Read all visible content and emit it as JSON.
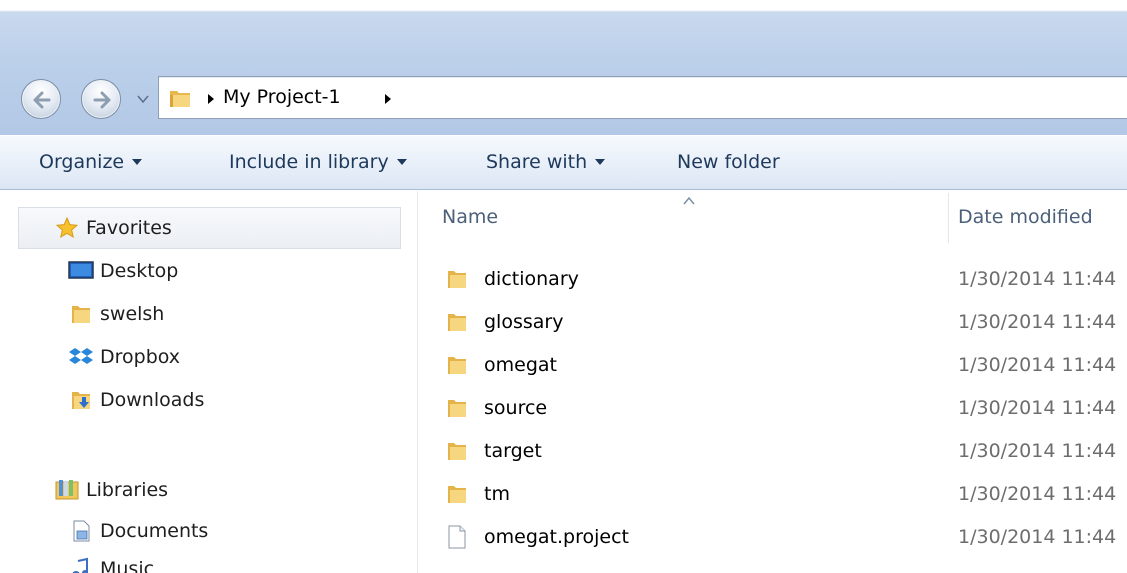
{
  "address": {
    "path_label": "My Project-1"
  },
  "toolbar": {
    "organize": "Organize",
    "include_in_library": "Include in library",
    "share_with": "Share with",
    "new_folder": "New folder"
  },
  "navigation": {
    "favorites": {
      "label": "Favorites",
      "items": [
        {
          "label": "Desktop",
          "icon": "desktop-icon"
        },
        {
          "label": "swelsh",
          "icon": "folder-icon"
        },
        {
          "label": "Dropbox",
          "icon": "dropbox-icon"
        },
        {
          "label": "Downloads",
          "icon": "downloads-icon"
        }
      ]
    },
    "libraries": {
      "label": "Libraries",
      "items": [
        {
          "label": "Documents",
          "icon": "documents-icon"
        },
        {
          "label": "Music",
          "icon": "music-icon"
        }
      ]
    }
  },
  "file_list": {
    "columns": {
      "name": "Name",
      "date_modified": "Date modified"
    },
    "rows": [
      {
        "name": "dictionary",
        "date": "1/30/2014 11:44",
        "type": "folder"
      },
      {
        "name": "glossary",
        "date": "1/30/2014 11:44",
        "type": "folder"
      },
      {
        "name": "omegat",
        "date": "1/30/2014 11:44",
        "type": "folder"
      },
      {
        "name": "source",
        "date": "1/30/2014 11:44",
        "type": "folder"
      },
      {
        "name": "target",
        "date": "1/30/2014 11:44",
        "type": "folder"
      },
      {
        "name": "tm",
        "date": "1/30/2014 11:44",
        "type": "folder"
      },
      {
        "name": "omegat.project",
        "date": "1/30/2014 11:44",
        "type": "file"
      }
    ]
  },
  "colors": {
    "toolbar_text": "#1e395b",
    "header_text": "#4c607a",
    "folder_yellow": "#f2c86a",
    "date_text": "#6d6d6d"
  }
}
